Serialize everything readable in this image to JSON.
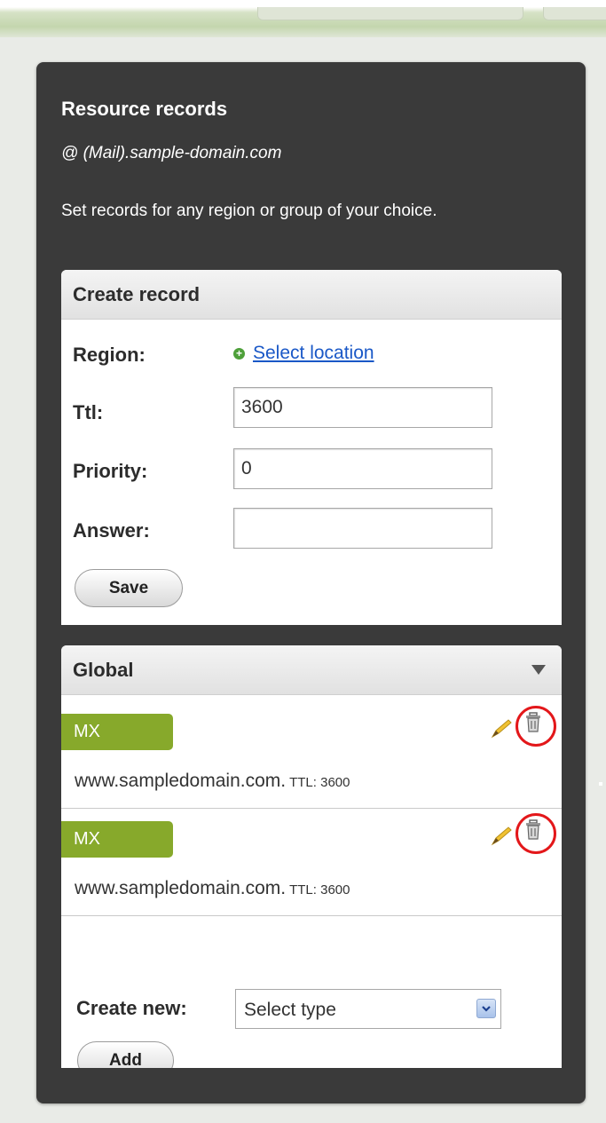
{
  "panel": {
    "title": "Resource records",
    "subtitle": "@ (Mail).sample-domain.com",
    "description": "Set records for any region or group of your choice."
  },
  "create_record": {
    "header": "Create record",
    "region_label": "Region:",
    "select_location": "Select location",
    "ttl_label": "Ttl:",
    "ttl_value": "3600",
    "priority_label": "Priority:",
    "priority_value": "0",
    "answer_label": "Answer:",
    "answer_value": "",
    "save_label": "Save"
  },
  "global": {
    "header": "Global",
    "records": [
      {
        "type": "MX",
        "value": "www.sampledomain.com.",
        "ttl": "TTL: 3600"
      },
      {
        "type": "MX",
        "value": "www.sampledomain.com.",
        "ttl": "TTL: 3600"
      }
    ],
    "create_new_label": "Create new:",
    "select_type": "Select type",
    "add_label": "Add"
  },
  "colors": {
    "panel_bg": "#3a3a3a",
    "badge_green": "#87a92b",
    "link_blue": "#1a58c7",
    "annotation_red": "#e3171a"
  },
  "icons": [
    "plus-icon",
    "chevron-down-icon",
    "pencil-icon",
    "trash-icon",
    "dropdown-arrow-icon"
  ]
}
